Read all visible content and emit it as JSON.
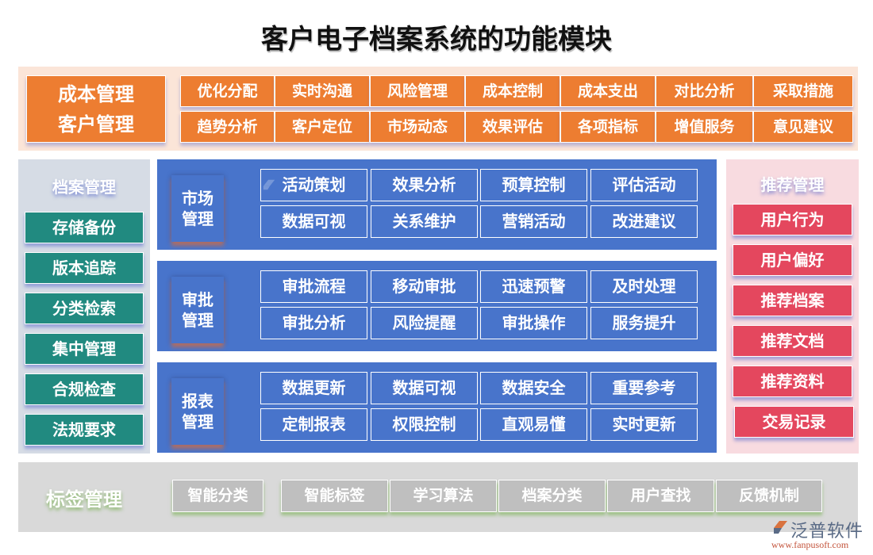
{
  "title": "客户电子档案系统的功能模块",
  "top": {
    "main_lines": [
      "成本管理",
      "客户管理"
    ],
    "row1": [
      "优化分配",
      "实时沟通",
      "风险管理",
      "成本控制",
      "成本支出",
      "对比分析",
      "采取措施"
    ],
    "row2": [
      "趋势分析",
      "客户定位",
      "市场动态",
      "效果评估",
      "各项指标",
      "增值服务",
      "意见建议"
    ]
  },
  "left": {
    "title": "档案管理",
    "items": [
      "存储备份",
      "版本追踪",
      "分类检索",
      "集中管理",
      "合规检查",
      "法规要求"
    ]
  },
  "center": [
    {
      "label_lines": [
        "市场",
        "管理"
      ],
      "row1": [
        "活动策划",
        "效果分析",
        "预算控制",
        "评估活动"
      ],
      "row2": [
        "数据可视",
        "关系维护",
        "营销活动",
        "改进建议"
      ]
    },
    {
      "label_lines": [
        "审批",
        "管理"
      ],
      "row1": [
        "审批流程",
        "移动审批",
        "迅速预警",
        "及时处理"
      ],
      "row2": [
        "审批分析",
        "风险提醒",
        "审批操作",
        "服务提升"
      ]
    },
    {
      "label_lines": [
        "报表",
        "管理"
      ],
      "row1": [
        "数据更新",
        "数据可视",
        "数据安全",
        "重要参考"
      ],
      "row2": [
        "定制报表",
        "权限控制",
        "直观易懂",
        "实时更新"
      ]
    }
  ],
  "right": {
    "title": "推荐管理",
    "items": [
      "用户行为",
      "用户偏好",
      "推荐档案",
      "推荐文档",
      "推荐资料",
      "交易记录"
    ]
  },
  "bottom": {
    "title": "标签管理",
    "items": [
      "智能分类",
      "智能标签",
      "学习算法",
      "档案分类",
      "用户查找",
      "反馈机制"
    ]
  },
  "logo": {
    "name": "泛普软件",
    "url": "www.fanpusoft.com"
  },
  "colors": {
    "orange": "#ed7d31",
    "teal": "#218a80",
    "blue": "#4874cb",
    "red": "#e4475e",
    "gray": "#bfbfbf"
  }
}
